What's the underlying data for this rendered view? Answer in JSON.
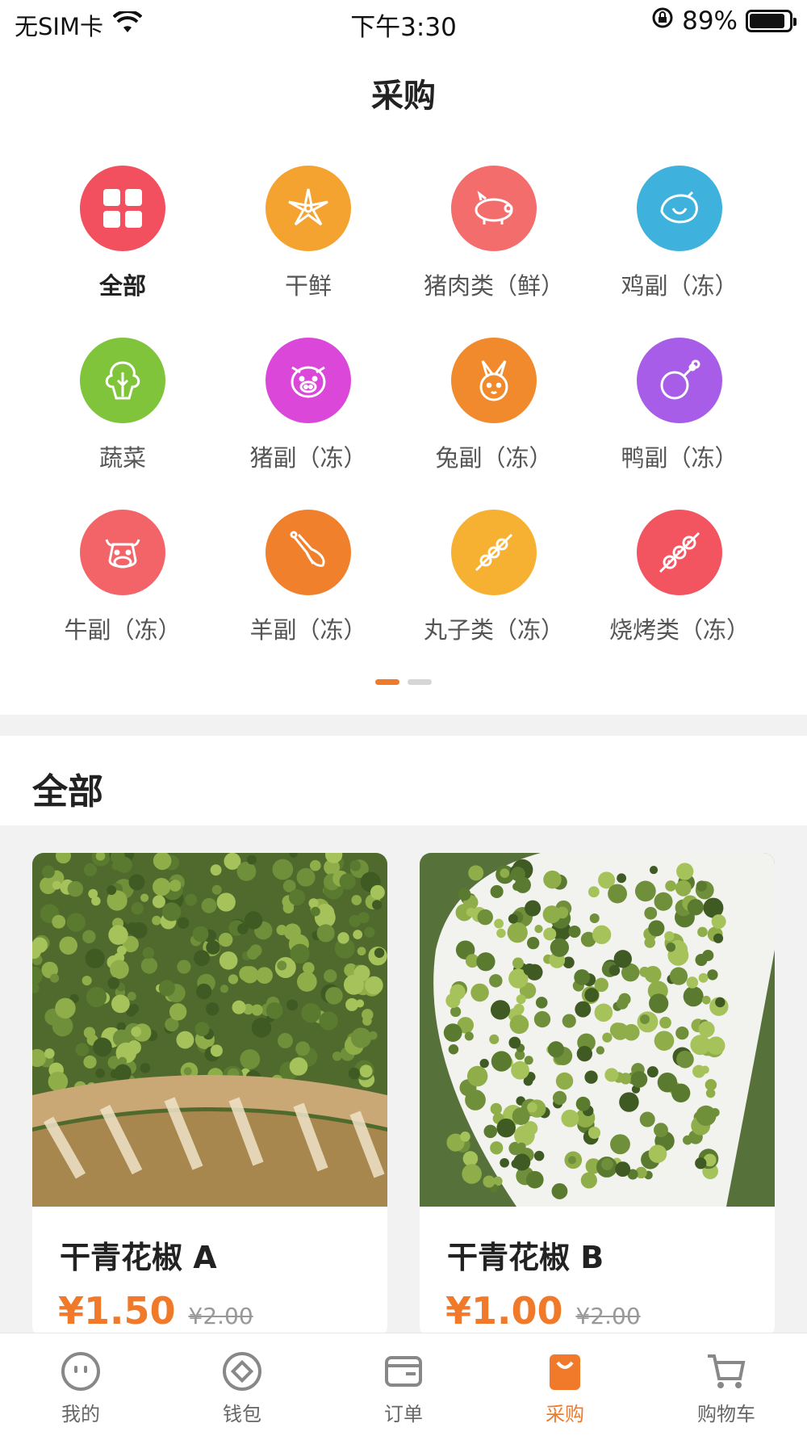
{
  "status_bar": {
    "carrier": "无SIM卡",
    "time": "下午3:30",
    "battery_percent": "89%",
    "battery_level": 0.89
  },
  "header": {
    "title": "采购"
  },
  "categories": [
    {
      "label": "全部",
      "icon": "grid-icon",
      "color": "#f2505e",
      "active": true
    },
    {
      "label": "干鲜",
      "icon": "star-anise-icon",
      "color": "#f4a330"
    },
    {
      "label": "猪肉类（鲜）",
      "icon": "pig-icon",
      "color": "#f36d6d"
    },
    {
      "label": "鸡副（冻）",
      "icon": "chicken-icon",
      "color": "#3fb1dd"
    },
    {
      "label": "蔬菜",
      "icon": "vegetable-icon",
      "color": "#7fc43a"
    },
    {
      "label": "猪副（冻）",
      "icon": "pig-face-icon",
      "color": "#db48d9"
    },
    {
      "label": "兔副（冻）",
      "icon": "rabbit-icon",
      "color": "#f08a2c"
    },
    {
      "label": "鸭副（冻）",
      "icon": "drumstick-icon",
      "color": "#a85de8"
    },
    {
      "label": "牛副（冻）",
      "icon": "cow-icon",
      "color": "#f26468"
    },
    {
      "label": "羊副（冻）",
      "icon": "lamb-leg-icon",
      "color": "#f0802c"
    },
    {
      "label": "丸子类（冻）",
      "icon": "skewer-icon",
      "color": "#f6b032"
    },
    {
      "label": "烧烤类（冻）",
      "icon": "bbq-skewer-icon",
      "color": "#f25460"
    }
  ],
  "section": {
    "title": "全部"
  },
  "products": [
    {
      "name": "干青花椒 A",
      "price": "¥1.50",
      "old_price": "¥2.00"
    },
    {
      "name": "干青花椒 B",
      "price": "¥1.00",
      "old_price": "¥2.00"
    }
  ],
  "tabbar": [
    {
      "label": "我的",
      "icon": "smiley-face-icon"
    },
    {
      "label": "钱包",
      "icon": "coin-icon"
    },
    {
      "label": "订单",
      "icon": "wallet-icon"
    },
    {
      "label": "采购",
      "icon": "shopping-bag-icon",
      "active": true
    },
    {
      "label": "购物车",
      "icon": "cart-icon"
    }
  ],
  "colors": {
    "accent": "#f07a2a",
    "background_gray": "#f2f2f2"
  }
}
